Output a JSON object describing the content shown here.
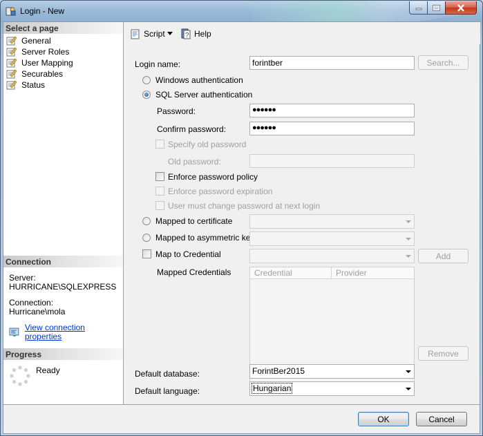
{
  "window": {
    "title": "Login - New"
  },
  "left": {
    "select_page_header": "Select a page",
    "pages": [
      {
        "label": "General"
      },
      {
        "label": "Server Roles"
      },
      {
        "label": "User Mapping"
      },
      {
        "label": "Securables"
      },
      {
        "label": "Status"
      }
    ],
    "connection_header": "Connection",
    "server_label": "Server:",
    "server_value": "HURRICANE\\SQLEXPRESS",
    "connection_label": "Connection:",
    "connection_value": "Hurricane\\mola",
    "view_props_link": "View connection properties",
    "progress_header": "Progress",
    "progress_status": "Ready"
  },
  "toolbar": {
    "script_label": "Script",
    "help_label": "Help"
  },
  "form": {
    "login_name_label": "Login name:",
    "login_name_value": "forintber",
    "search_button": "Search...",
    "windows_auth_label": "Windows authentication",
    "sql_auth_label": "SQL Server authentication",
    "sql_auth_selected": true,
    "password_label": "Password:",
    "password_value": "●●●●●●",
    "confirm_password_label": "Confirm password:",
    "confirm_password_value": "●●●●●●",
    "specify_old_password_label": "Specify old password",
    "old_password_label": "Old password:",
    "enforce_policy_label": "Enforce password policy",
    "enforce_expiration_label": "Enforce password expiration",
    "must_change_label": "User must change password at next login",
    "mapped_cert_label": "Mapped to certificate",
    "mapped_asym_label": "Mapped to asymmetric key",
    "map_credential_label": "Map to Credential",
    "add_button": "Add",
    "mapped_credentials_label": "Mapped Credentials",
    "credentials_columns": [
      "Credential",
      "Provider"
    ],
    "remove_button": "Remove",
    "default_database_label": "Default database:",
    "default_database_value": "ForintBer2015",
    "default_language_label": "Default language:",
    "default_language_value": "Hungarian"
  },
  "footer": {
    "ok_button": "OK",
    "cancel_button": "Cancel"
  }
}
